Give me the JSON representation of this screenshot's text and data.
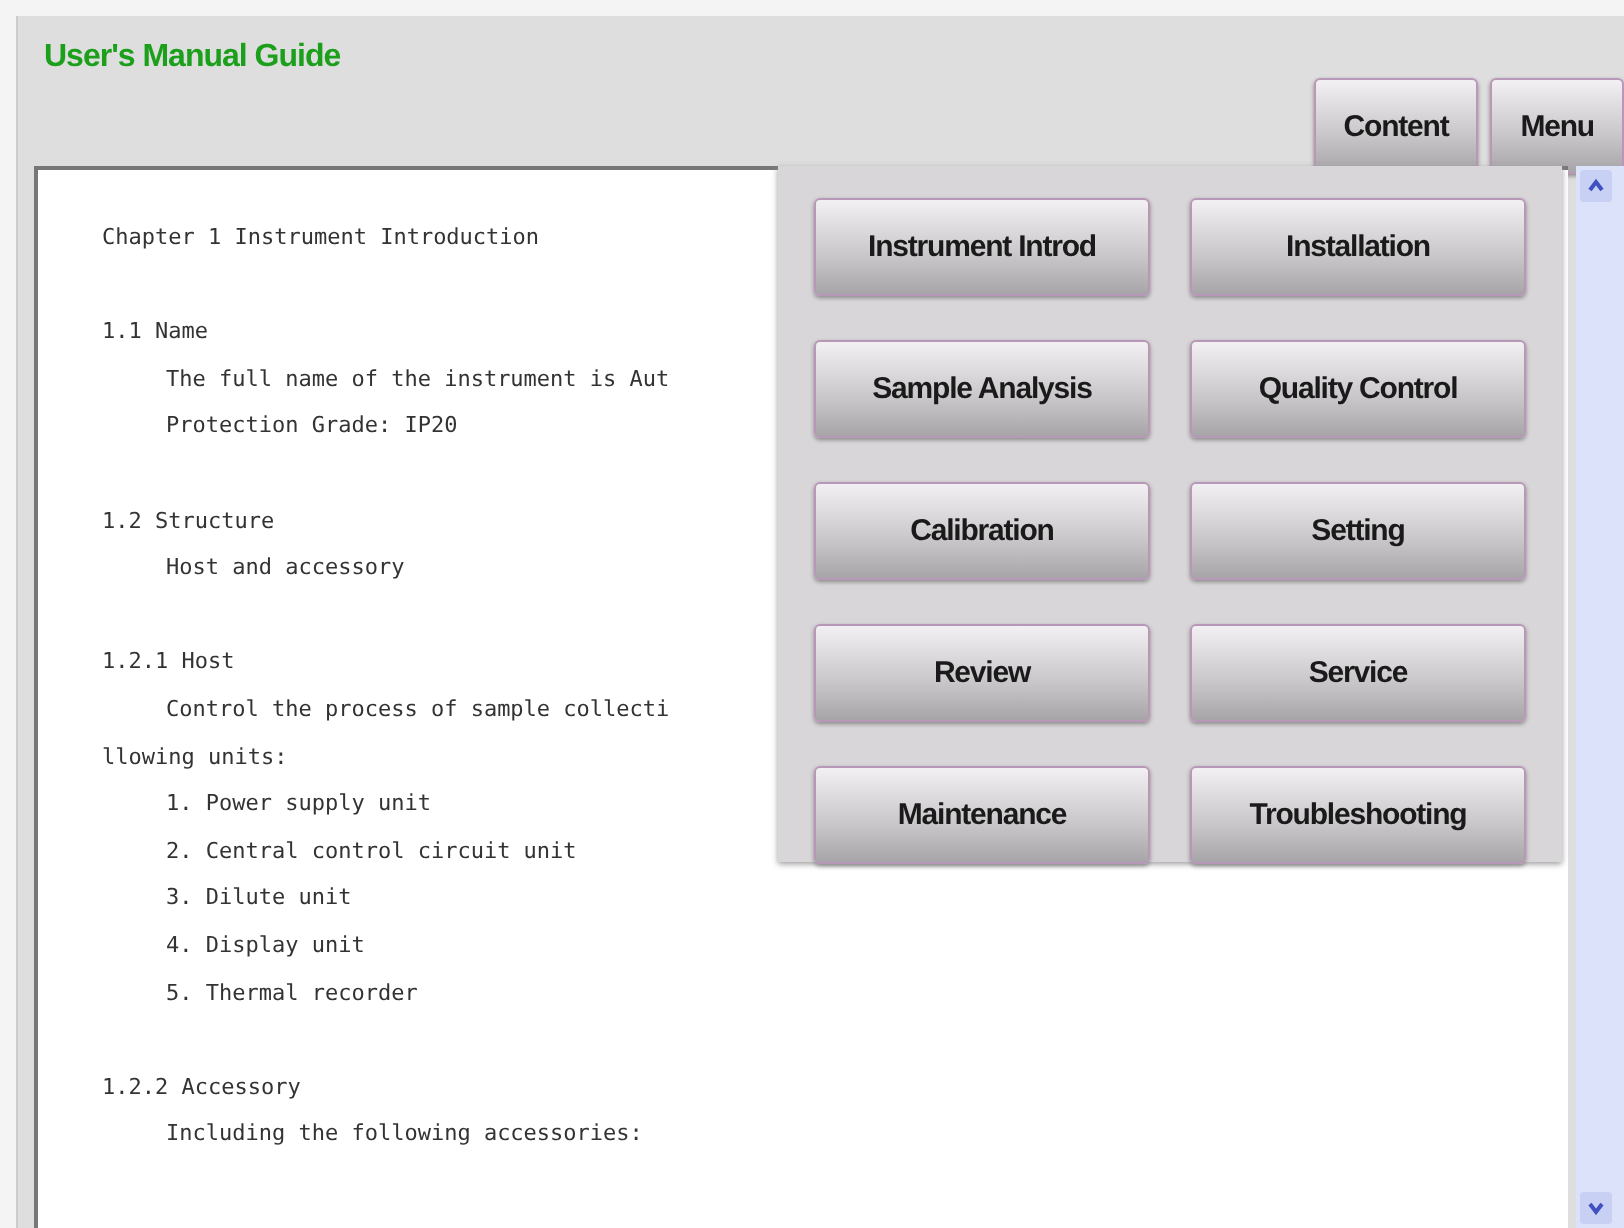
{
  "window": {
    "title": "User's Manual Guide"
  },
  "header_buttons": [
    "Content",
    "Menu"
  ],
  "document": {
    "lines": [
      {
        "kind": "heading",
        "text": "Chapter 1 Instrument Introduction"
      },
      {
        "kind": "heading",
        "text": "1.1 Name"
      },
      {
        "kind": "body",
        "text": "The full name of the instrument is Aut"
      },
      {
        "kind": "body",
        "text": "Protection Grade: IP20"
      },
      {
        "kind": "heading",
        "text": "1.2 Structure"
      },
      {
        "kind": "body",
        "text": "Host and accessory"
      },
      {
        "kind": "heading",
        "text": "1.2.1 Host"
      },
      {
        "kind": "body",
        "text": "Control the process of sample collecti"
      },
      {
        "kind": "continuation",
        "text": "llowing units:"
      },
      {
        "kind": "body",
        "text": "1. Power supply unit"
      },
      {
        "kind": "body",
        "text": "2. Central control circuit unit"
      },
      {
        "kind": "body",
        "text": "3. Dilute unit"
      },
      {
        "kind": "body",
        "text": "4. Display unit"
      },
      {
        "kind": "body",
        "text": "5. Thermal recorder"
      },
      {
        "kind": "heading",
        "text": "1.2.2 Accessory"
      },
      {
        "kind": "body",
        "text": "Including the following accessories:"
      }
    ]
  },
  "menu_popup": {
    "items": [
      "Instrument Introd",
      "Installation",
      "Sample Analysis",
      "Quality Control",
      "Calibration",
      "Setting",
      "Review",
      "Service",
      "Maintenance",
      "Troubleshooting"
    ]
  }
}
